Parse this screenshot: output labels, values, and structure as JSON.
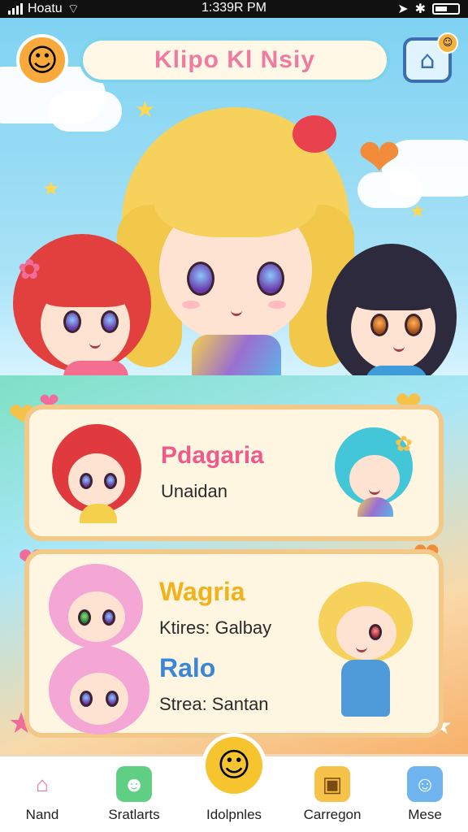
{
  "status_bar": {
    "carrier": "Hoatu",
    "time": "1:339R PM",
    "battery_icon": "battery-icon",
    "signal_icon": "signal-bars-icon",
    "wifi_icon": "wifi-icon"
  },
  "header": {
    "title": "Klipo Kl Nsiy",
    "avatar_icon": "smiley-icon",
    "home_icon": "home-icon",
    "home_badge": "☺"
  },
  "cards": [
    {
      "name": "Pdagaria",
      "subtitle": "Unaidan"
    },
    {
      "name": "Wagria",
      "subtitle": "Ktires: Galbay",
      "name2": "Ralo",
      "subtitle2": "Strea: Santan"
    }
  ],
  "nav": {
    "items": [
      {
        "label": "Nand",
        "icon": "home-icon",
        "color": "#f06c9b"
      },
      {
        "label": "Sratlarts",
        "icon": "character-icon",
        "color": "#5fcf84"
      },
      {
        "label": "Idolpnles",
        "icon": "smiley-icon",
        "color": "#f6c42f"
      },
      {
        "label": "Carregon",
        "icon": "box-icon",
        "color": "#f6c24a"
      },
      {
        "label": "Mese",
        "icon": "robot-icon",
        "color": "#6fb4ef"
      }
    ]
  },
  "colors": {
    "title_text": "#f07aa0",
    "card_border": "#f3c98a",
    "card_bg": "#fff6e2",
    "sky": "#7fd2f2"
  }
}
